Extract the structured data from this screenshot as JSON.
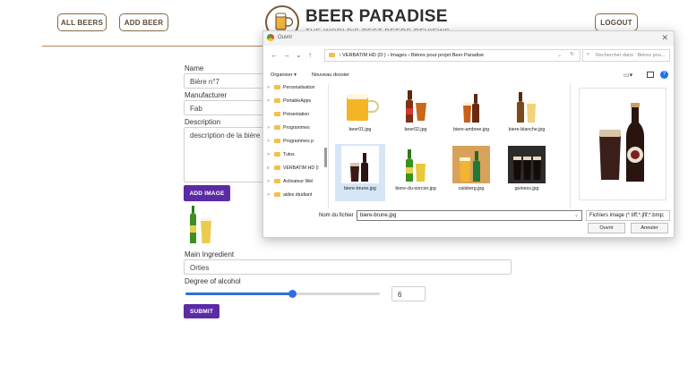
{
  "header": {
    "all_beers_label": "ALL BEERS",
    "add_beer_label": "ADD BEER",
    "brand_title": "BEER PARADISE",
    "tagline": "THE WORLD'S BEST BEERS REVIEWS",
    "logout_label": "LOGOUT"
  },
  "form": {
    "name_label": "Name",
    "name_value": "Bière n°7",
    "manufacturer_label": "Manufacturer",
    "manufacturer_value": "Fab",
    "description_label": "Description",
    "description_value": "description de la bière n°7",
    "add_image_label": "ADD IMAGE",
    "main_ingredient_label": "Main Ingredient",
    "main_ingredient_value": "Orties",
    "alcohol_label": "Degree of alcohol",
    "alcohol_value": "6",
    "alcohol_slider_fraction": 0.55,
    "submit_label": "SUBMIT"
  },
  "dialog": {
    "title": "Ouvrir",
    "close_symbol": "✕",
    "path_segments": [
      "VERBATIM HD (D:)",
      "Images",
      "Bières pour projet Beer Paradise"
    ],
    "search_placeholder": "Rechercher dans : Bières pou...",
    "organize_label": "Organiser ▾",
    "new_folder_label": "Nouveau dossier",
    "nav_items": [
      {
        "label": "Personalisation",
        "expand": ">"
      },
      {
        "label": "PortableApps",
        "expand": ">"
      },
      {
        "label": "Présentation",
        "expand": ""
      },
      {
        "label": "Programmes",
        "expand": ">"
      },
      {
        "label": "Programmes p",
        "expand": ">"
      },
      {
        "label": "Tutos",
        "expand": ">"
      },
      {
        "label": "VERBATIM HD (I",
        "expand": "v"
      },
      {
        "label": "Activateur Wel",
        "expand": ">"
      },
      {
        "label": "aides étudiant",
        "expand": ">"
      }
    ],
    "files": [
      {
        "name": "beer01.jpg",
        "kind": "mug"
      },
      {
        "name": "beer02.jpg",
        "kind": "bottle-glass"
      },
      {
        "name": "biere-ambree.jpg",
        "kind": "amber"
      },
      {
        "name": "biere-blanche.jpg",
        "kind": "blanche"
      },
      {
        "name": "biere-brune.jpg",
        "kind": "brune"
      },
      {
        "name": "biere-du-sorcier.jpg",
        "kind": "sorcier"
      },
      {
        "name": "calsberg.jpg",
        "kind": "calsberg"
      },
      {
        "name": "guiness.jpg",
        "kind": "guiness"
      }
    ],
    "selected_file_index": 4,
    "filename_label": "Nom du fichier :",
    "filename_value": "biere-brune.jpg",
    "filetype_value": "Fichiers image (*.tiff;*.jfif;*.bmp;",
    "open_label": "Ouvrir",
    "cancel_label": "Annuler"
  },
  "colors": {
    "accent_purple": "#5b2ba6",
    "slider_blue": "#2f6fdc",
    "header_brown": "#b8865a"
  }
}
